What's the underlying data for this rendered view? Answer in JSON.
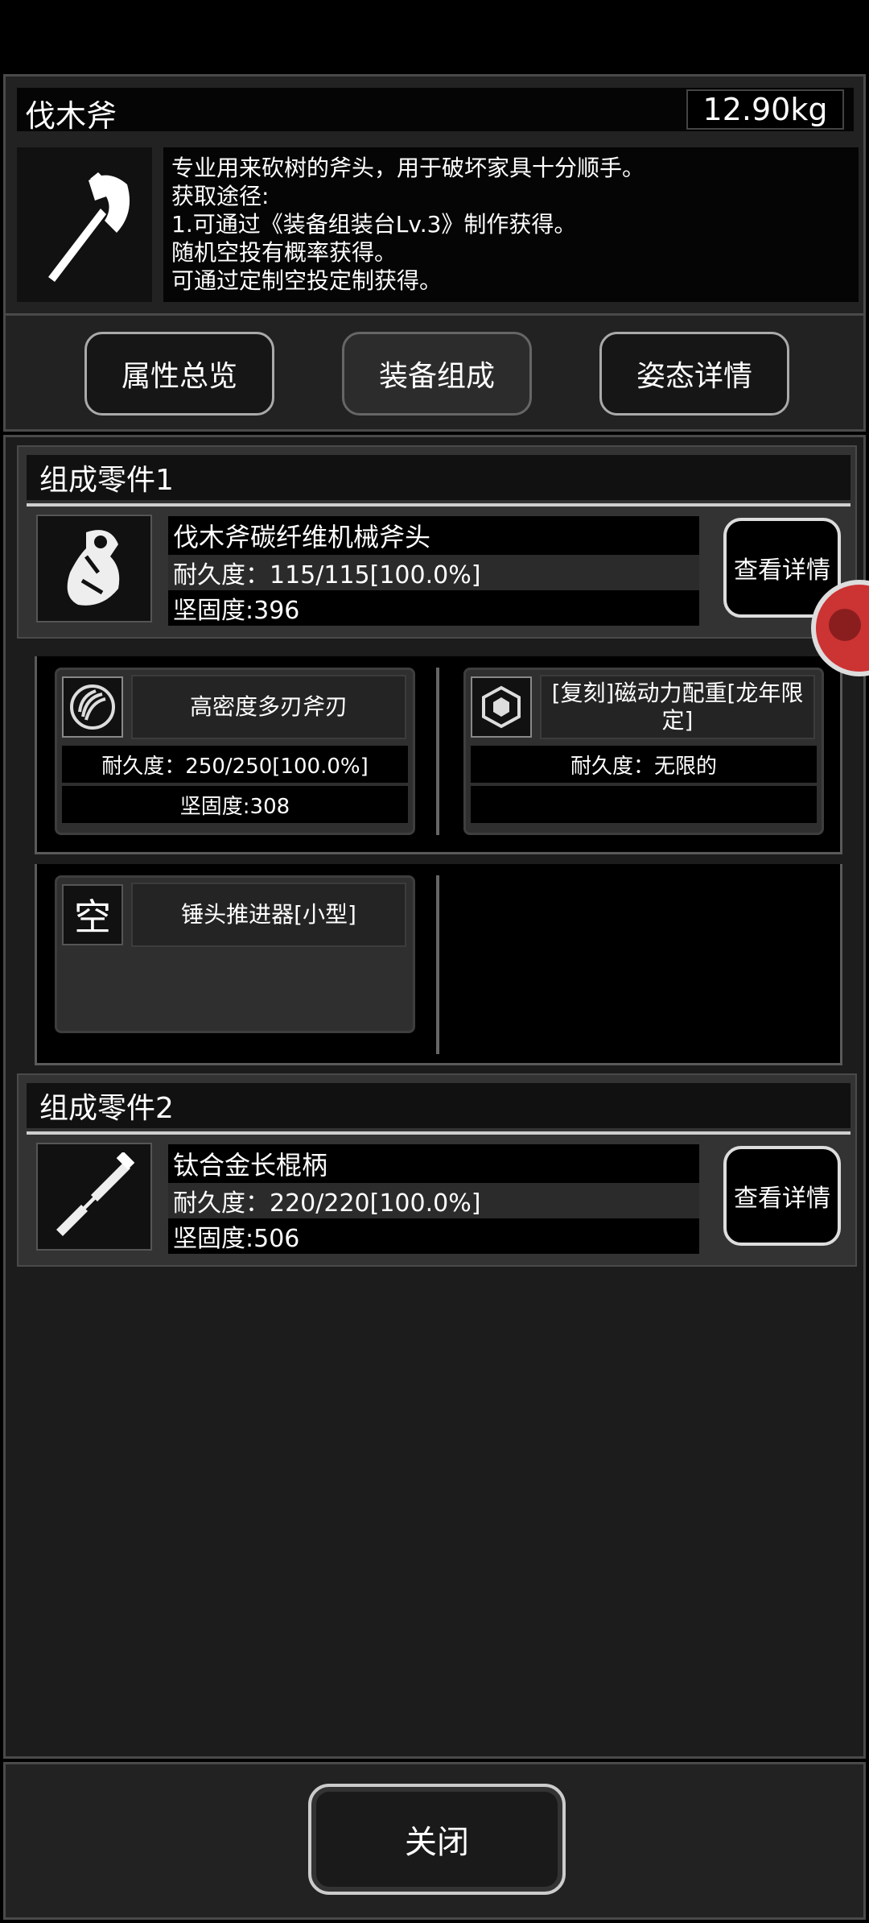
{
  "item": {
    "name": "伐木斧",
    "weight": "12.90kg",
    "desc_lines": [
      "专业用来砍树的斧头，用于破坏家具十分顺手。",
      "获取途径:",
      "1.可通过《装备组装台Lv.3》制作获得。",
      "随机空投有概率获得。",
      "可通过定制空投定制获得。"
    ]
  },
  "tabs": [
    "属性总览",
    "装备组成",
    "姿态详情"
  ],
  "sections": [
    {
      "title": "组成零件1",
      "part": {
        "name": "伐木斧碳纤维机械斧头",
        "durability": "耐久度：115/115[100.0%]",
        "hardness": "坚固度:396",
        "button": "查看详情"
      },
      "subparts": [
        {
          "name": "高密度多刃斧刃",
          "durability": "耐久度：250/250[100.0%]",
          "hardness": "坚固度:308"
        },
        {
          "name": "[复刻]磁动力配重[龙年限定]",
          "durability": "耐久度：无限的",
          "hardness": ""
        },
        {
          "name": "锤头推进器[小型]",
          "icon_text": "空"
        }
      ]
    },
    {
      "title": "组成零件2",
      "part": {
        "name": "钛合金长棍柄",
        "durability": "耐久度：220/220[100.0%]",
        "hardness": "坚固度:506",
        "button": "查看详情"
      }
    }
  ],
  "close_label": "关闭",
  "icons": {
    "item": "axe-icon",
    "part1": "mechanical-axe-head-icon",
    "part2": "titanium-handle-icon",
    "sub1": "multi-blade-icon",
    "sub2": "magnetic-counterweight-icon",
    "float": "floating-assistant-icon"
  }
}
